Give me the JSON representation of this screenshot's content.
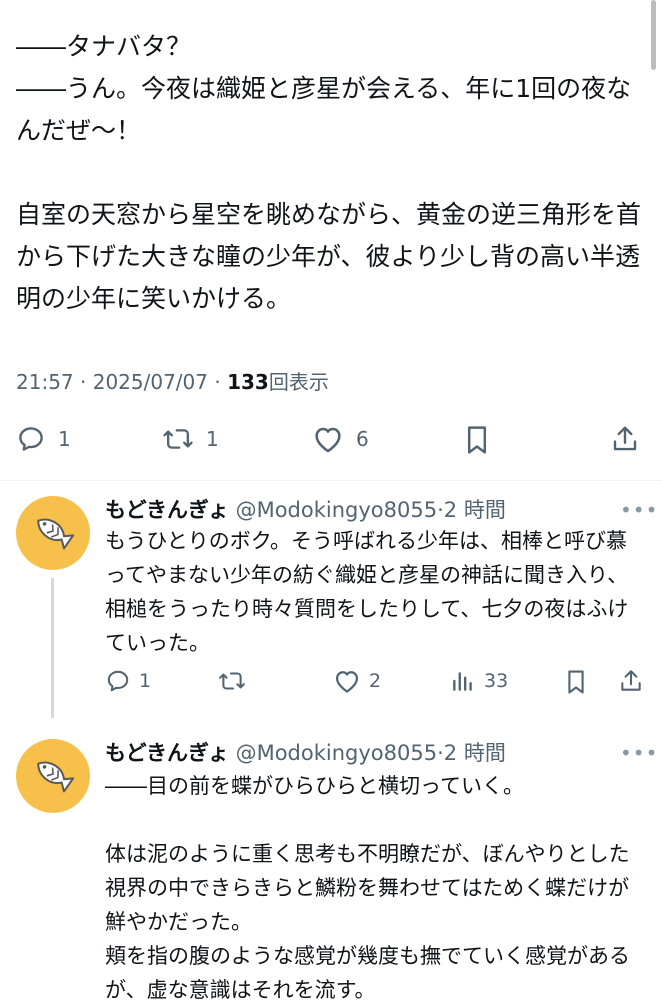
{
  "main_post": {
    "text": "――タナバタ？\n――うん。今夜は織姫と彦星が会える、年に1回の夜なんだぜ～！\n\n自室の天窓から星空を眺めながら、黄金の逆三角形を首から下げた大きな瞳の少年が、彼より少し背の高い半透明の少年に笑いかける。",
    "time": "21:57",
    "date": "2025/07/07",
    "views_count": "133",
    "views_label": "回表示",
    "meta_sep": "·",
    "reply_count": "1",
    "repost_count": "1",
    "like_count": "6"
  },
  "replies": [
    {
      "display_name": "もどきんぎょ",
      "handle": "@Modokingyo8055",
      "sep": "·",
      "time": "2 時間",
      "more": "•••",
      "text": "もうひとりのボク。そう呼ばれる少年は、相棒と呼び慕ってやまない少年の紡ぐ織姫と彦星の神話に聞き入り、相槌をうったり時々質問をしたりして、七夕の夜はふけていった。",
      "reply_count": "1",
      "repost_count": "",
      "like_count": "2",
      "view_count": "33"
    },
    {
      "display_name": "もどきんぎょ",
      "handle": "@Modokingyo8055",
      "sep": "·",
      "time": "2 時間",
      "more": "•••",
      "text": "――目の前を蝶がひらひらと横切っていく。\n\n体は泥のように重く思考も不明瞭だが、ぼんやりとした視界の中できらきらと鱗粉を舞わせてはためく蝶だけが鮮やかだった。\n頬を指の腹のような感覚が幾度も撫でていく感覚があるが、虚な意識はそれを流す。"
    }
  ],
  "colors": {
    "text": "#0f1419",
    "secondary": "#536471",
    "avatar_bg": "#f6c04a",
    "thread_line": "#cfd9de"
  },
  "icons": {
    "reply": "speech-bubble-icon",
    "repost": "repost-arrows-icon",
    "like": "heart-icon",
    "bookmark": "bookmark-icon",
    "share": "share-upload-icon",
    "views": "bar-chart-icon",
    "avatar": "fish-icon"
  }
}
